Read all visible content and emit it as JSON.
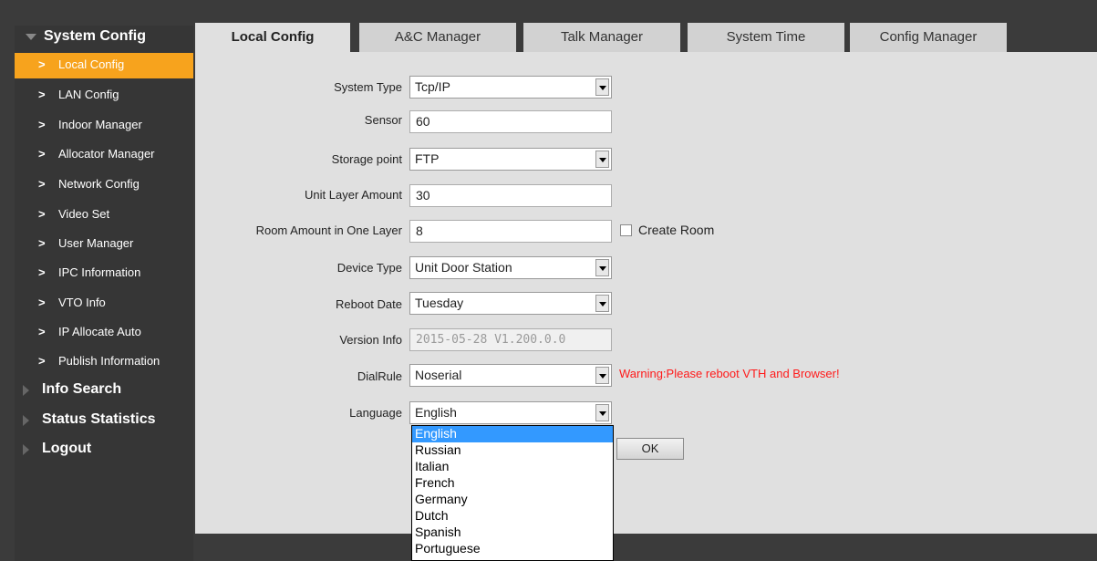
{
  "sidebar": {
    "section": "System Config",
    "items": [
      {
        "label": "Local Config"
      },
      {
        "label": "LAN Config"
      },
      {
        "label": "Indoor Manager"
      },
      {
        "label": "Allocator Manager"
      },
      {
        "label": "Network Config"
      },
      {
        "label": "Video Set"
      },
      {
        "label": "User Manager"
      },
      {
        "label": "IPC Information"
      },
      {
        "label": "VTO Info"
      },
      {
        "label": "IP Allocate Auto"
      },
      {
        "label": "Publish Information"
      }
    ],
    "categories": [
      {
        "label": "Info Search"
      },
      {
        "label": "Status Statistics"
      },
      {
        "label": "Logout"
      }
    ],
    "active_color": "#f7a31d"
  },
  "tabs": [
    {
      "label": "Local Config"
    },
    {
      "label": "A&C Manager"
    },
    {
      "label": "Talk Manager"
    },
    {
      "label": "System Time"
    },
    {
      "label": "Config Manager"
    }
  ],
  "form": {
    "system_type": {
      "label": "System Type",
      "value": "Tcp/IP"
    },
    "sensor": {
      "label": "Sensor",
      "value": "60"
    },
    "storage_point": {
      "label": "Storage point",
      "value": "FTP"
    },
    "unit_layer_amount": {
      "label": "Unit Layer Amount",
      "value": "30"
    },
    "room_amount": {
      "label": "Room Amount in One Layer",
      "value": "8"
    },
    "create_room": {
      "label": "Create Room",
      "checked": false
    },
    "device_type": {
      "label": "Device Type",
      "value": "Unit Door Station"
    },
    "reboot_date": {
      "label": "Reboot Date",
      "value": "Tuesday"
    },
    "version_info": {
      "label": "Version Info",
      "value": "2015-05-28 V1.200.0.0"
    },
    "dial_rule": {
      "label": "DialRule",
      "value": "Noserial"
    },
    "warning": "Warning:Please reboot VTH and Browser!",
    "language": {
      "label": "Language",
      "value": "English",
      "options": [
        "English",
        "Russian",
        "Italian",
        "French",
        "Germany",
        "Dutch",
        "Spanish",
        "Portuguese"
      ]
    },
    "ok_label": "OK"
  },
  "colors": {
    "warning": "#ff1a1a",
    "highlight": "#3399ff"
  }
}
